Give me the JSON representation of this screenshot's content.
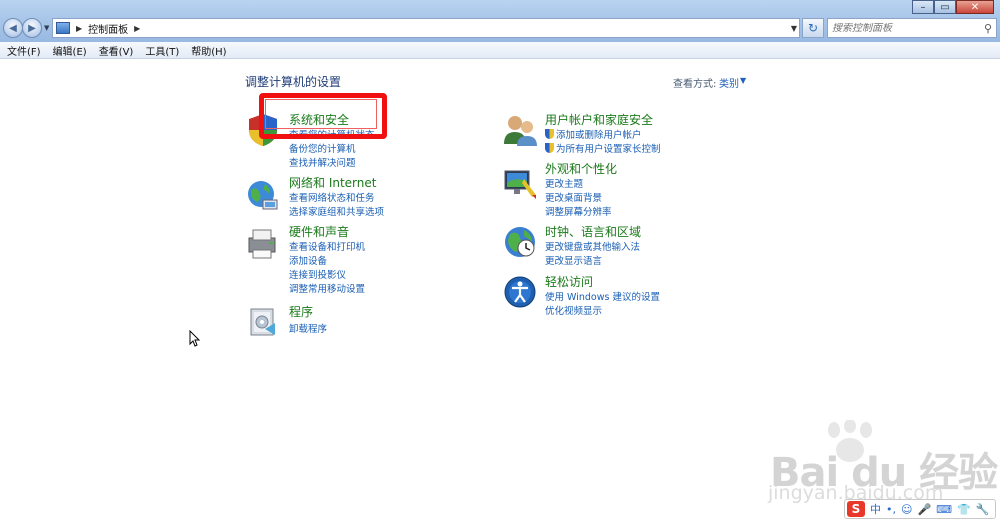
{
  "window": {
    "address": {
      "path": "控制面板"
    },
    "search": {
      "placeholder": "搜索控制面板"
    },
    "caption": {
      "minimize": "–",
      "maximize": "▭",
      "close": "✕"
    }
  },
  "menu": [
    "文件(F)",
    "编辑(E)",
    "查看(V)",
    "工具(T)",
    "帮助(H)"
  ],
  "main": {
    "heading": "调整计算机的设置",
    "view_by_label": "查看方式:",
    "view_by_value": "类别"
  },
  "categories_left": [
    {
      "title": "系统和安全",
      "links": [
        "查看您的计算机状态",
        "备份您的计算机",
        "查找并解决问题"
      ],
      "icon": "shield-icon"
    },
    {
      "title": "网络和 Internet",
      "links": [
        "查看网络状态和任务",
        "选择家庭组和共享选项"
      ],
      "icon": "network-icon"
    },
    {
      "title": "硬件和声音",
      "links": [
        "查看设备和打印机",
        "添加设备",
        "连接到投影仪",
        "调整常用移动设置"
      ],
      "icon": "printer-icon"
    },
    {
      "title": "程序",
      "links": [
        "卸载程序"
      ],
      "icon": "programs-icon"
    }
  ],
  "categories_right": [
    {
      "title": "用户帐户和家庭安全",
      "links": [
        "添加或删除用户帐户",
        "为所有用户设置家长控制"
      ],
      "icon": "users-icon"
    },
    {
      "title": "外观和个性化",
      "links": [
        "更改主题",
        "更改桌面背景",
        "调整屏幕分辨率"
      ],
      "icon": "appearance-icon"
    },
    {
      "title": "时钟、语言和区域",
      "links": [
        "更改键盘或其他输入法",
        "更改显示语言"
      ],
      "icon": "clock-globe-icon"
    },
    {
      "title": "轻松访问",
      "links": [
        "使用 Windows 建议的设置",
        "优化视频显示"
      ],
      "icon": "ease-of-access-icon"
    }
  ],
  "watermark": {
    "brand": "Bai du 经验",
    "url": "jingyan.baidu.com"
  },
  "ime": {
    "logo": "S",
    "lang": "中",
    "items": [
      "•,",
      "☺",
      "🎤",
      "⌨",
      "👕",
      "🔧"
    ]
  },
  "colors": {
    "title_green": "#1a7a1a",
    "link_blue": "#1a5fb4",
    "highlight_red": "#f01010"
  }
}
